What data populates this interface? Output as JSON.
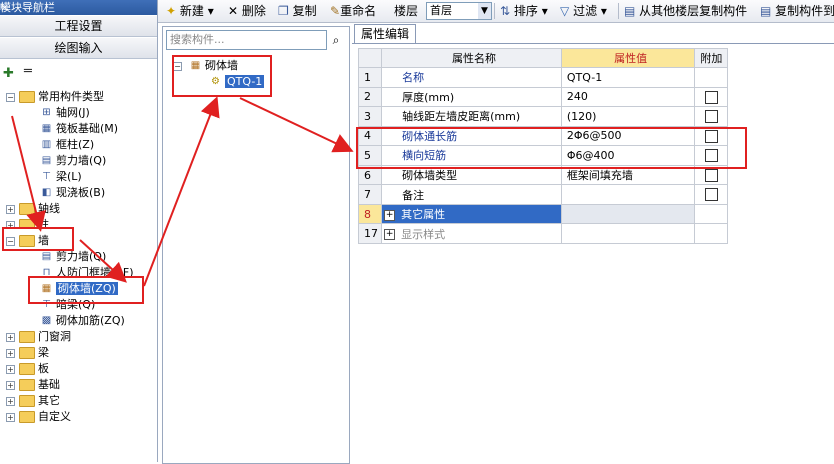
{
  "nav": {
    "title": "模块导航栏",
    "pin_glyph": "ᵖ",
    "close_glyph": "×",
    "project_settings": "工程设置",
    "drawing_input": "绘图输入",
    "tree": {
      "common_types": "常用构件类型",
      "common_children": [
        "轴网(J)",
        "筏板基础(M)",
        "框柱(Z)",
        "剪力墙(Q)",
        "梁(L)",
        "现浇板(B)"
      ],
      "axis": "轴线",
      "column": "柱",
      "wall": "墙",
      "wall_children": [
        "剪力墙(Q)",
        "人防门框墙(RF)",
        "砌体墙(ZQ)",
        "暗梁(Q)",
        "砌体加筋(ZQ)"
      ],
      "others": [
        "门窗洞",
        "梁",
        "板",
        "基础",
        "其它",
        "自定义"
      ]
    }
  },
  "toolbar": {
    "new": "新建",
    "delete": "删除",
    "copy": "复制",
    "rename": "重命名",
    "floor_label": "楼层",
    "floor_value": "首层",
    "sort": "排序",
    "filter": "过滤",
    "copy_from_floor": "从其他楼层复制构件",
    "copy_to_floor": "复制构件到"
  },
  "middle": {
    "search_placeholder": "搜索构件...",
    "tree_root": "砌体墙",
    "tree_child": "QTQ-1"
  },
  "props": {
    "tab": "属性编辑",
    "headers": {
      "name": "属性名称",
      "value": "属性值",
      "extra": "附加"
    },
    "rows": [
      {
        "num": "1",
        "name": "名称",
        "value": "QTQ-1",
        "blue": true,
        "check": false
      },
      {
        "num": "2",
        "name": "厚度(mm)",
        "value": "240",
        "blue": false,
        "check": true
      },
      {
        "num": "3",
        "name": "轴线距左墙皮距离(mm)",
        "value": "(120)",
        "blue": false,
        "check": true
      },
      {
        "num": "4",
        "name": "砌体通长筋",
        "value": "2Φ6@500",
        "blue": true,
        "check": true
      },
      {
        "num": "5",
        "name": "横向短筋",
        "value": "Φ6@400",
        "blue": true,
        "check": true
      },
      {
        "num": "6",
        "name": "砌体墙类型",
        "value": "框架间填充墙",
        "blue": false,
        "check": true
      },
      {
        "num": "7",
        "name": "备注",
        "value": "",
        "blue": false,
        "check": true
      },
      {
        "num": "8",
        "name": "其它属性",
        "value": "",
        "group": true,
        "selected": true
      },
      {
        "num": "17",
        "name": "显示样式",
        "value": "",
        "group": true,
        "grey": true
      }
    ]
  },
  "colors": {
    "annotation": "#e02020",
    "selection": "#316ac5",
    "value_header": "#fbe79a"
  }
}
